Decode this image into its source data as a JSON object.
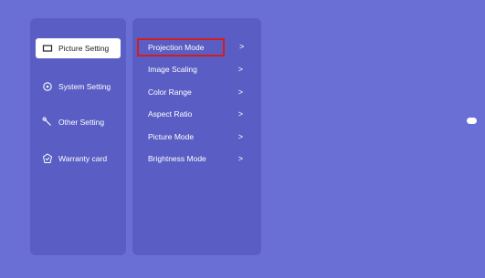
{
  "left_menu": {
    "items": [
      {
        "label": "Picture Setting",
        "icon": "screen-rectangle-icon",
        "selected": true
      },
      {
        "label": "System Setting",
        "icon": "target-circle-icon",
        "selected": false
      },
      {
        "label": "Other Setting",
        "icon": "wrench-icon",
        "selected": false
      },
      {
        "label": "Warranty card",
        "icon": "warranty-badge-icon",
        "selected": false
      }
    ]
  },
  "submenu": {
    "items": [
      {
        "label": "Projection Mode",
        "focused": true
      },
      {
        "label": "Image Scaling"
      },
      {
        "label": "Color Range"
      },
      {
        "label": "Aspect Ratio"
      },
      {
        "label": "Picture Mode"
      },
      {
        "label": "Brightness Mode"
      }
    ],
    "chevron": ">"
  },
  "colors": {
    "background": "#6a6fd6",
    "panel": "#5a5ec4",
    "focus_outline": "#d01e1e"
  }
}
